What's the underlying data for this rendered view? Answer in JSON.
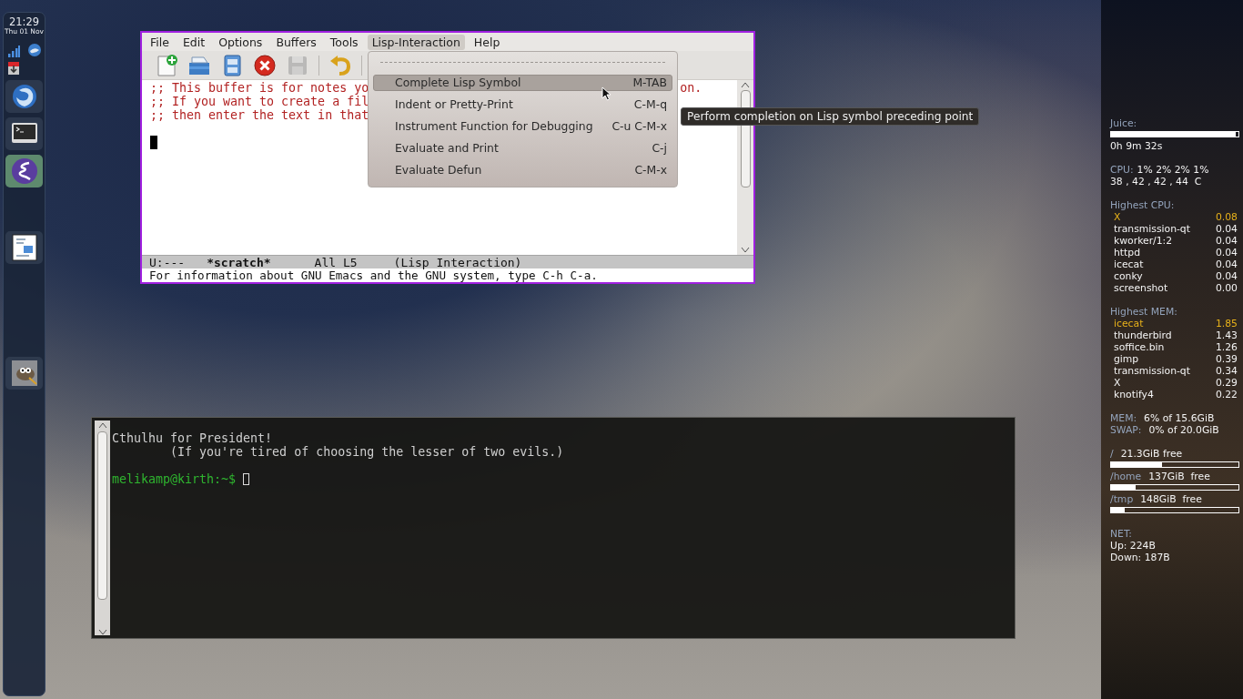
{
  "panel": {
    "clock": {
      "time": "21:29",
      "date": "Thu 01 Nov"
    },
    "launchers": [
      {
        "kind": "browser",
        "selected": false
      },
      {
        "kind": "terminal",
        "selected": false
      },
      {
        "kind": "editor",
        "selected": true
      },
      {
        "kind": "document",
        "selected": false
      },
      {
        "kind": "paint",
        "selected": false
      }
    ]
  },
  "emacs": {
    "menu": [
      {
        "label": "File",
        "selected": false
      },
      {
        "label": "Edit",
        "selected": false
      },
      {
        "label": "Options",
        "selected": false
      },
      {
        "label": "Buffers",
        "selected": false
      },
      {
        "label": "Tools",
        "selected": false
      },
      {
        "label": "Lisp-Interaction",
        "selected": true
      },
      {
        "label": "Help",
        "selected": false
      }
    ],
    "toolbar": [
      {
        "kind": "new",
        "disabled": false
      },
      {
        "kind": "open",
        "disabled": false
      },
      {
        "kind": "archive",
        "disabled": false
      },
      {
        "kind": "close",
        "disabled": false
      },
      {
        "kind": "save",
        "disabled": true
      },
      {
        "kind": "undo",
        "disabled": false
      }
    ],
    "buffer_lines": [
      ";; This buffer is for notes yo",
      ";; If you want to create a fil",
      ";; then enter the text in that"
    ],
    "buffer_tail": "on.",
    "mode_line": {
      "status": "U:---",
      "buffer": "*scratch*",
      "position": "All L5",
      "mode": "(Lisp Interaction)"
    },
    "echo": "For information about GNU Emacs and the GNU system, type C-h C-a."
  },
  "popup_menu": {
    "items": [
      {
        "label": "Complete Lisp Symbol",
        "shortcut": "M-TAB",
        "selected": true
      },
      {
        "label": "Indent or Pretty-Print",
        "shortcut": "C-M-q",
        "selected": false
      },
      {
        "label": "Instrument Function for Debugging",
        "shortcut": "C-u C-M-x",
        "selected": false
      },
      {
        "label": "Evaluate and Print",
        "shortcut": "C-j",
        "selected": false
      },
      {
        "label": "Evaluate Defun",
        "shortcut": "C-M-x",
        "selected": false
      }
    ],
    "tooltip": "Perform completion on Lisp symbol preceding point"
  },
  "terminal": {
    "lines": [
      "Cthulhu for President!",
      "        (If you're tired of choosing the lesser of two evils.)"
    ],
    "prompt": "melikamp@kirth:~$"
  },
  "conky": {
    "battery": {
      "label": "Juice:",
      "level": 0.98,
      "time": "0h 9m 32s"
    },
    "cpu": {
      "label": "CPU:",
      "usage": "1% 2% 2% 1%",
      "temps": "38 , 42 , 42 , 44  C"
    },
    "top_cpu": {
      "title": "Highest CPU:",
      "rows": [
        {
          "name": "X",
          "value": "0.08",
          "top": true
        },
        {
          "name": "transmission-qt",
          "value": "0.04",
          "top": false
        },
        {
          "name": "kworker/1:2",
          "value": "0.04",
          "top": false
        },
        {
          "name": "httpd",
          "value": "0.04",
          "top": false
        },
        {
          "name": "icecat",
          "value": "0.04",
          "top": false
        },
        {
          "name": "conky",
          "value": "0.04",
          "top": false
        },
        {
          "name": "screenshot",
          "value": "0.00",
          "top": false
        }
      ]
    },
    "top_mem": {
      "title": "Highest MEM:",
      "rows": [
        {
          "name": "icecat",
          "value": "1.85",
          "top": true
        },
        {
          "name": "thunderbird",
          "value": "1.43",
          "top": false
        },
        {
          "name": "soffice.bin",
          "value": "1.26",
          "top": false
        },
        {
          "name": "gimp",
          "value": "0.39",
          "top": false
        },
        {
          "name": "transmission-qt",
          "value": "0.34",
          "top": false
        },
        {
          "name": "X",
          "value": "0.29",
          "top": false
        },
        {
          "name": "knotify4",
          "value": "0.22",
          "top": false
        }
      ]
    },
    "memory": [
      {
        "label": "MEM:",
        "value": "6% of 15.6GiB"
      },
      {
        "label": "SWAP:",
        "value": "0% of 20.0GiB"
      }
    ],
    "disks": [
      {
        "mount": "/",
        "free": "21.3GiB free",
        "level": 0.4
      },
      {
        "mount": "/home",
        "free": "137GiB  free",
        "level": 0.19
      },
      {
        "mount": "/tmp",
        "free": "148GiB  free",
        "level": 0.11
      }
    ],
    "net": {
      "label": "NET:",
      "up": "Up: 224B",
      "down": "Down: 187B"
    }
  }
}
